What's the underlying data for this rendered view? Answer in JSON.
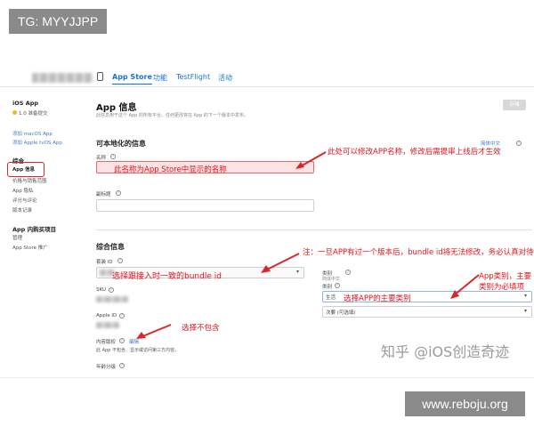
{
  "watermarks": {
    "top_left": "TG: MYYJJPP",
    "bottom_right": "www.reboju.org",
    "zhihu": "知乎 @iOS创造奇迹"
  },
  "header": {
    "tabs": [
      {
        "label": "App Store"
      },
      {
        "label": "功能"
      },
      {
        "label": "TestFlight"
      },
      {
        "label": "活动"
      }
    ]
  },
  "sidebar": {
    "platform": "iOS App",
    "version_status": "1.0 准备提交",
    "add_links": [
      "添加 macOS App",
      "添加 Apple tvOS App"
    ],
    "general_heading": "综合",
    "general_items": [
      "App 信息",
      "价格与销售范围",
      "App 隐私",
      "评分与评论",
      "版本记录"
    ],
    "iap_heading": "App 内购买项目",
    "iap_items": [
      "管理",
      "App Store 推广"
    ]
  },
  "main": {
    "title": "App 信息",
    "subtitle": "此信息用于这个 App 的所有平台。任何更改将在 App 的下一个版本中发布。",
    "save_button": "存储",
    "localizable_heading": "可本地化的信息",
    "language_select": "简体中文",
    "name_label": "名称",
    "subtitle_label": "副标题",
    "general_info_heading": "综合信息",
    "bundle_id_label": "套装 ID",
    "sku_label": "SKU",
    "apple_id_label": "Apple ID",
    "content_rights_label": "内容版权",
    "content_rights_edit": "编辑",
    "content_rights_value": "此 App 不包含、显示或访问第三方内容。",
    "age_rating_label": "年龄分级",
    "category_heading": "类别",
    "category_lang": "简体中文",
    "category_label": "类别",
    "primary_category": "生活",
    "secondary_category": "次要 (可选填)"
  },
  "annotations": {
    "name_field_note": "此名称为App Store中显示的名称",
    "name_side_note": "此处可以修改APP名称，修改后需提审上线后才生效",
    "bundle_field_note": "选择跟接入时一致的bundle id",
    "bundle_side_note": "注：一旦APP有过一个版本后，bundle id将无法修改，务必认真对待",
    "category_field_note": "选择APP的主要类别",
    "category_side_note": "App类别，主要类别为必填项",
    "content_note": "选择不包含"
  }
}
